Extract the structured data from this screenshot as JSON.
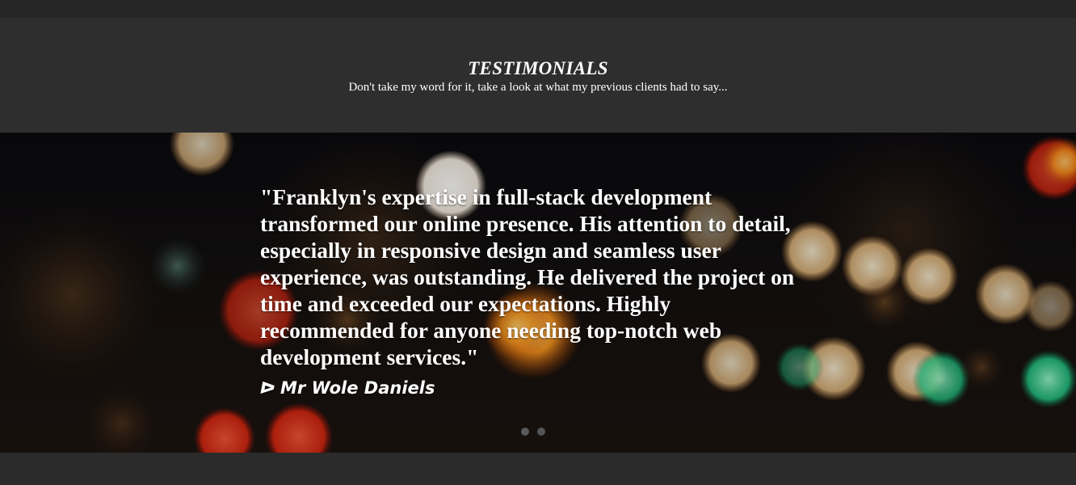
{
  "header": {
    "title": "TESTIMONIALS",
    "subtitle": "Don't take my word for it, take a look at what my previous clients had to say..."
  },
  "testimonial": {
    "quote": "\"Franklyn's expertise in full-stack development transformed our online presence. His attention to detail, especially in responsive design and seamless user experience, was outstanding. He delivered the project on time and exceeded our expectations. Highly recommended for anyone needing top-notch web development services.\"",
    "author_icon": "play-outline-icon",
    "author_icon_glyph": "ᐅ",
    "author": "Mr Wole Daniels"
  },
  "slider": {
    "slide_count": 2,
    "active_index": 0,
    "dot_color": "#555555"
  },
  "colors": {
    "page_background": "#2b2b2b",
    "header_background": "#2e2e2e",
    "text": "#ffffff"
  }
}
